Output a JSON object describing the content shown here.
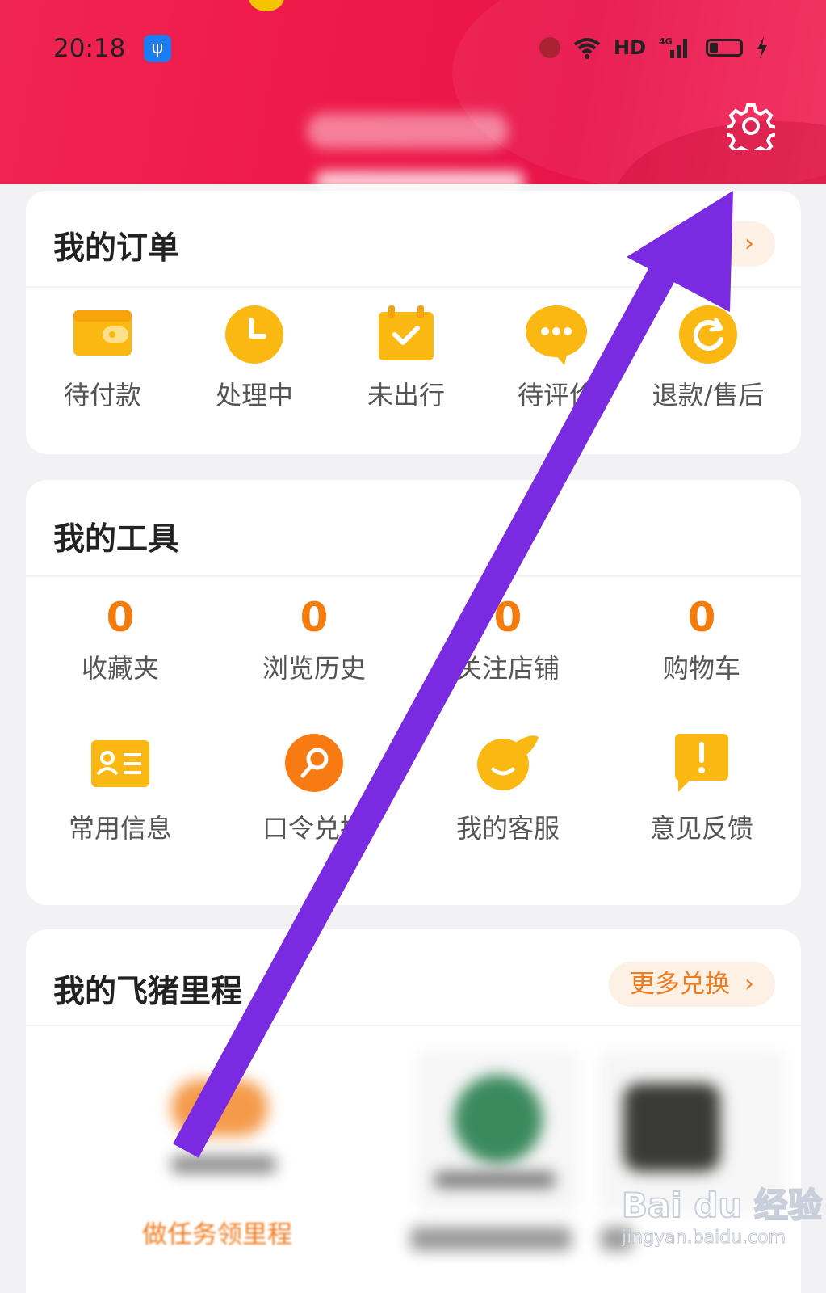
{
  "status_bar": {
    "time": "20:18",
    "usb_icon": "usb-icon",
    "hd": "HD",
    "network": "4G"
  },
  "header": {
    "settings_icon": "gear-icon",
    "accent_color": "#f0204e"
  },
  "orders": {
    "title": "我的订单",
    "all_label": "全部",
    "items": [
      {
        "label": "待付款",
        "icon": "wallet-icon"
      },
      {
        "label": "处理中",
        "icon": "clock-icon"
      },
      {
        "label": "未出行",
        "icon": "calendar-check-icon"
      },
      {
        "label": "待评价",
        "icon": "chat-bubble-icon"
      },
      {
        "label": "退款/售后",
        "icon": "refund-icon"
      }
    ]
  },
  "tools": {
    "title": "我的工具",
    "stats": [
      {
        "count": "0",
        "label": "收藏夹"
      },
      {
        "count": "0",
        "label": "浏览历史"
      },
      {
        "count": "0",
        "label": "关注店铺"
      },
      {
        "count": "0",
        "label": "购物车"
      }
    ],
    "items": [
      {
        "label": "常用信息",
        "icon": "id-card-icon"
      },
      {
        "label": "口令兑换",
        "icon": "search-key-icon"
      },
      {
        "label": "我的客服",
        "icon": "customer-service-icon"
      },
      {
        "label": "意见反馈",
        "icon": "feedback-icon"
      }
    ]
  },
  "mileage": {
    "title": "我的飞猪里程",
    "more_label": "更多兑换",
    "task_label": "做任务领里程"
  },
  "watermark": {
    "logo": "Bai du 经验",
    "url": "jingyan.baidu.com"
  },
  "annotation": {
    "arrow_color": "#7a2ae0"
  }
}
